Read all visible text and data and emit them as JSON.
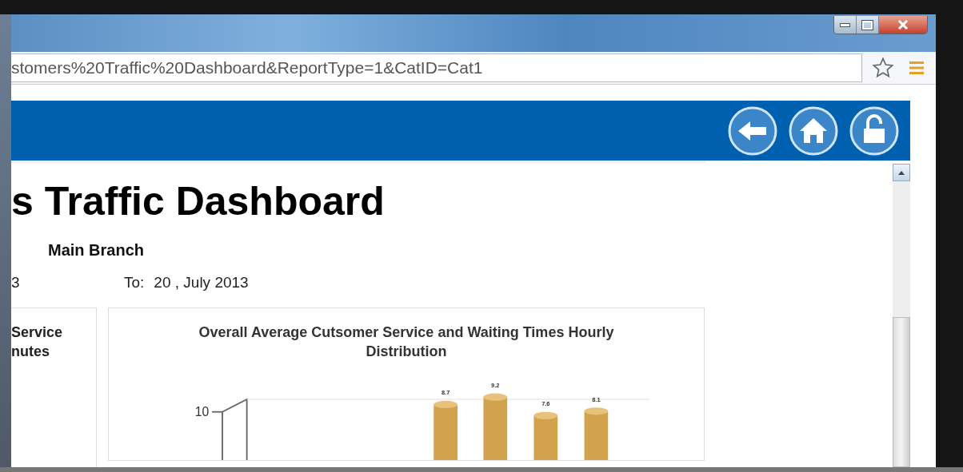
{
  "browser": {
    "url": "stomers%20Traffic%20Dashboard&ReportType=1&CatID=Cat1"
  },
  "page": {
    "title": "s Traffic Dashboard",
    "branch": "Main Branch",
    "from_fragment": "3",
    "to_label": "To:",
    "to_date": "20 , July 2013"
  },
  "left_card": {
    "lines": [
      "Service",
      "nutes"
    ]
  },
  "chart": {
    "title": "Overall Average Cutsomer Service and Waiting Times Hourly Distribution",
    "y_tick": "10",
    "bar_labels": [
      "8.7",
      "9.2",
      "7.6",
      "8.1"
    ]
  }
}
